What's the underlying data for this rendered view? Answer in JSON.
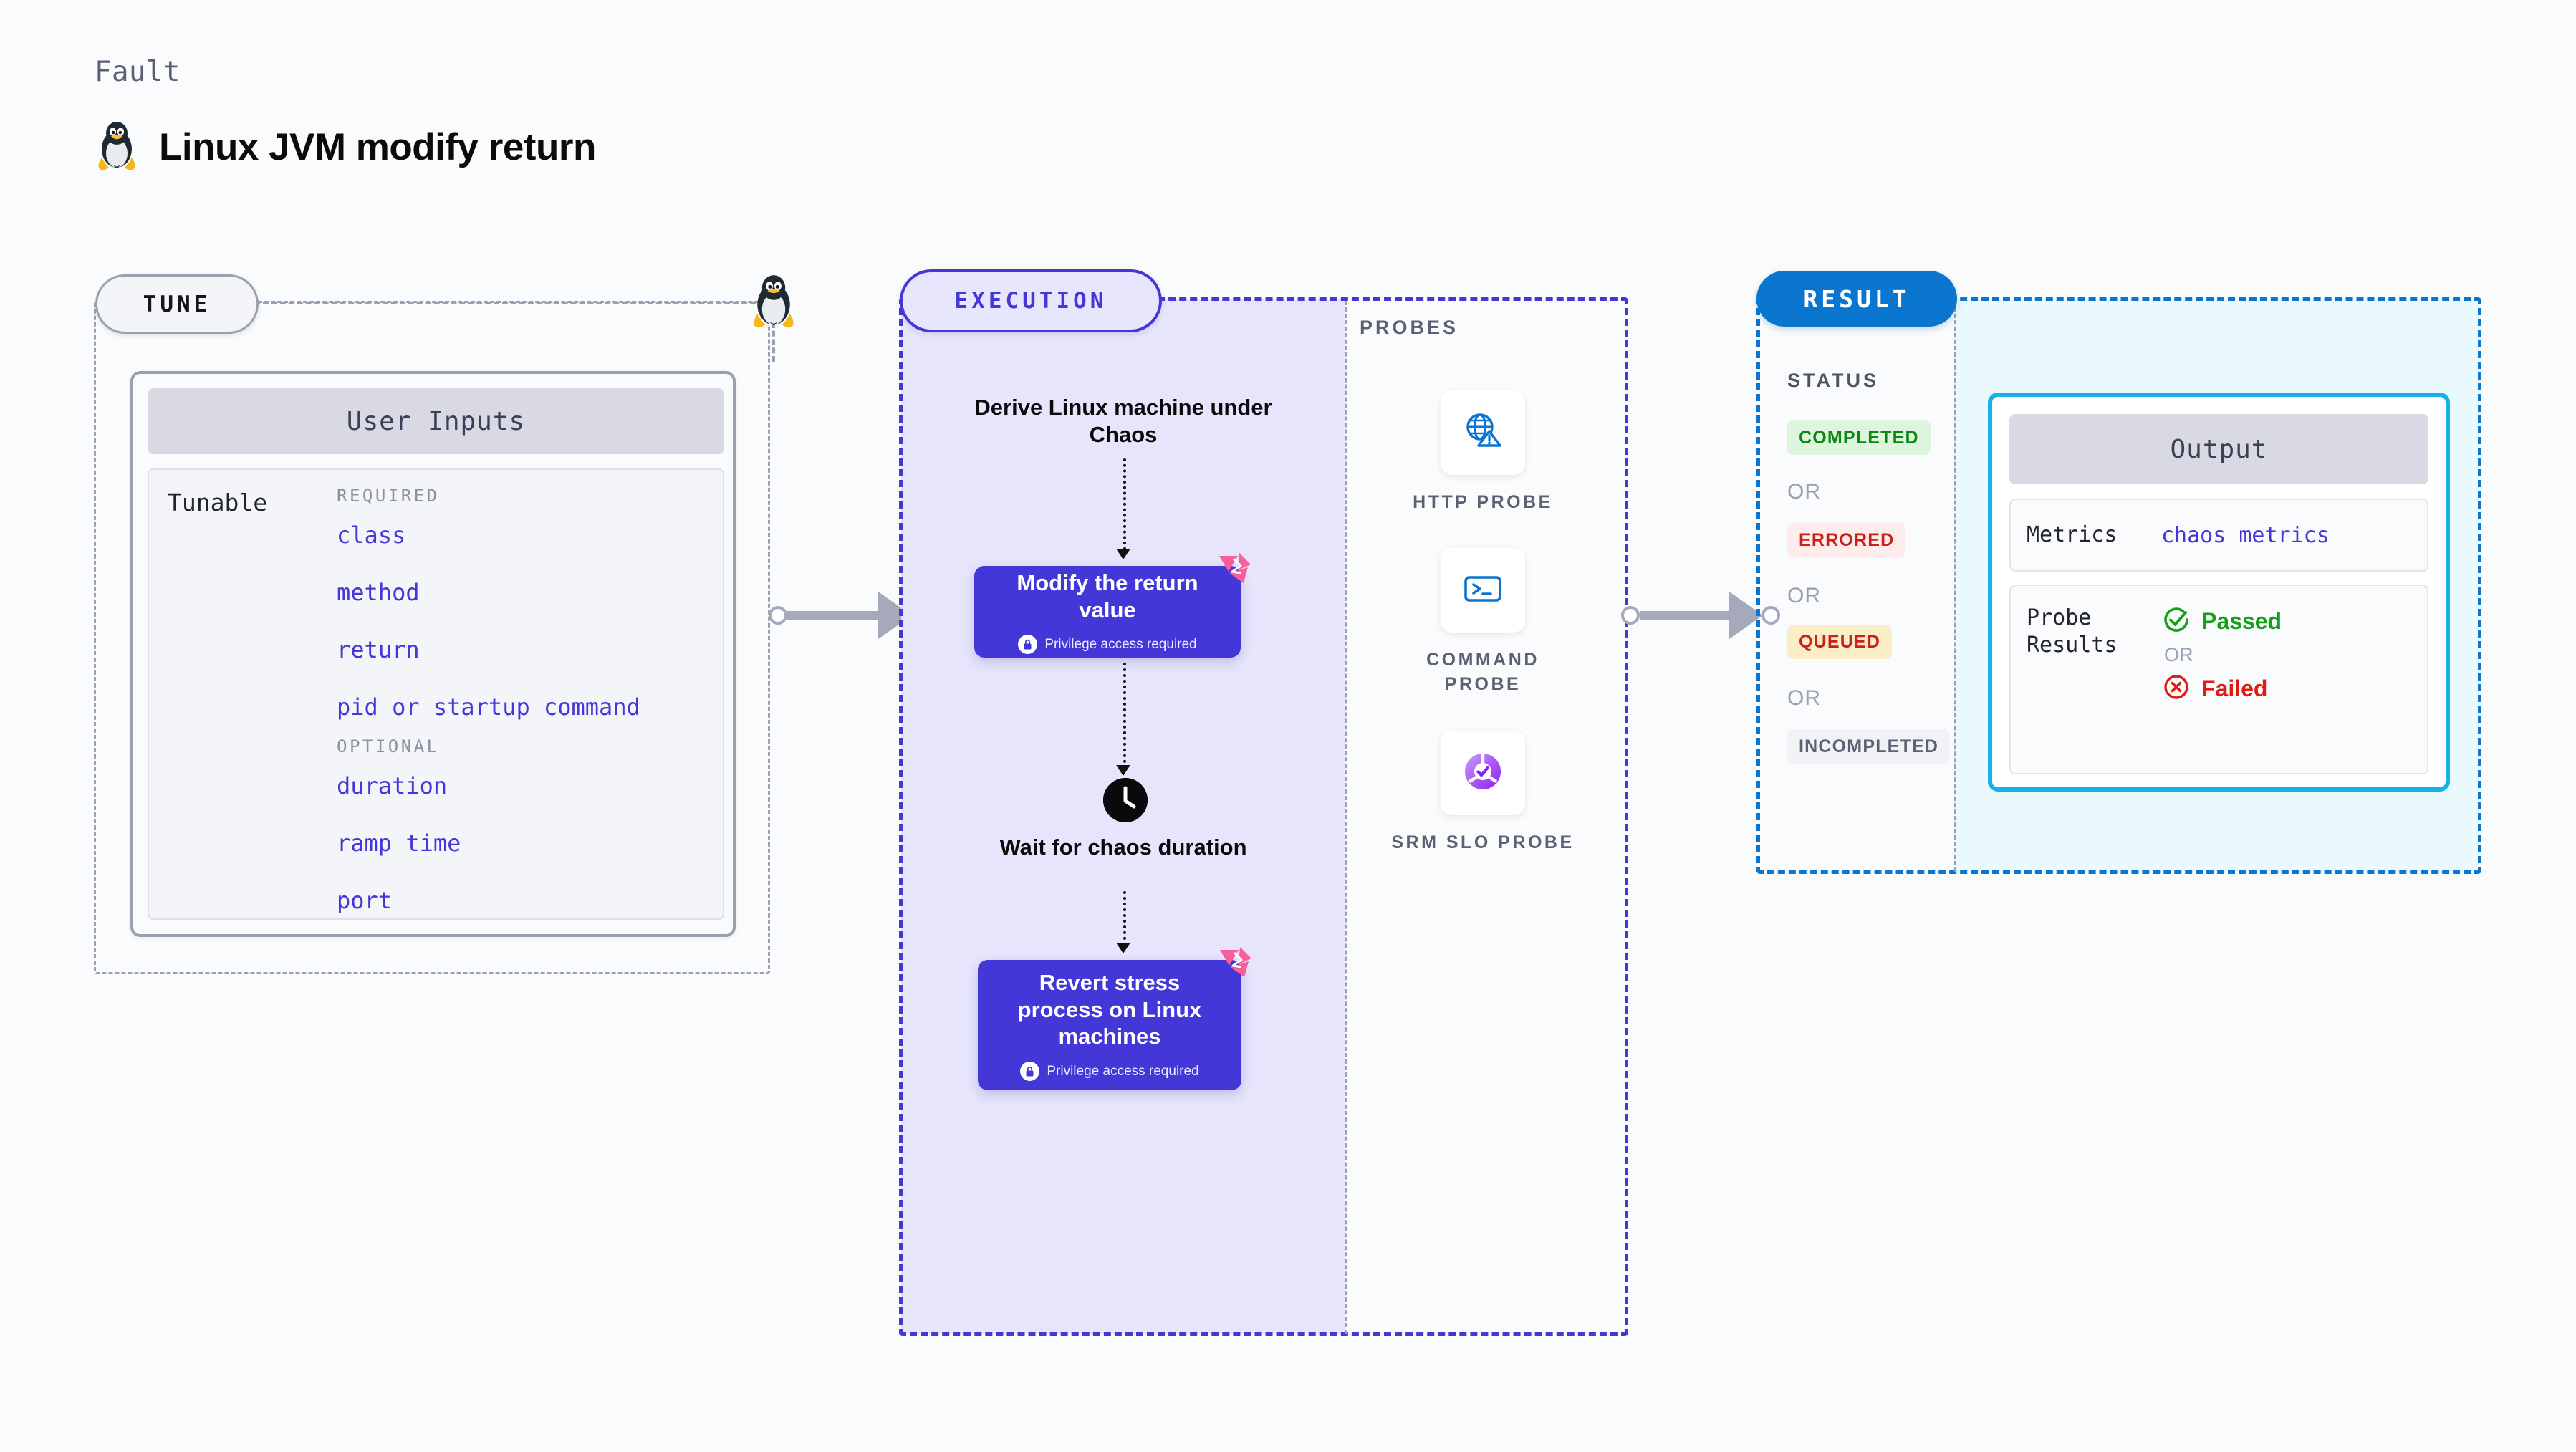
{
  "header": {
    "kicker": "Fault",
    "title": "Linux JVM modify return",
    "icon": "linux-tux-icon"
  },
  "tune": {
    "pill_label": "TUNE",
    "card_title": "User Inputs",
    "tunable_label": "Tunable",
    "required_label": "REQUIRED",
    "optional_label": "OPTIONAL",
    "required_items": [
      "class",
      "method",
      "return",
      "pid or startup command"
    ],
    "optional_items": [
      "duration",
      "ramp time",
      "port"
    ]
  },
  "execution": {
    "pill_label": "EXECUTION",
    "derive_text": "Derive Linux machine under Chaos",
    "modify_box": {
      "title": "Modify the return value",
      "sub": "Privilege access required",
      "badge_icon": "harness-chaos-icon",
      "lock_icon": "lock-icon"
    },
    "wait_text": "Wait for chaos duration",
    "clock_icon": "clock-icon",
    "revert_box": {
      "title": "Revert stress process on Linux machines",
      "sub": "Privilege access required",
      "badge_icon": "harness-chaos-icon",
      "lock_icon": "lock-icon"
    }
  },
  "probes": {
    "label": "PROBES",
    "items": [
      {
        "caption": "HTTP PROBE",
        "icon": "globe-warning-icon"
      },
      {
        "caption": "COMMAND PROBE",
        "icon": "terminal-icon"
      },
      {
        "caption": "SRM SLO PROBE",
        "icon": "srm-slo-icon"
      }
    ]
  },
  "result": {
    "pill_label": "RESULT",
    "status_label": "STATUS",
    "or_label": "OR",
    "statuses": [
      {
        "label": "COMPLETED",
        "bg": "#ddf5dc",
        "fg": "#0e8712"
      },
      {
        "label": "ERRORED",
        "bg": "#fdeceb",
        "fg": "#c9201a"
      },
      {
        "label": "QUEUED",
        "bg": "#fbeec6",
        "fg": "#c9201a"
      },
      {
        "label": "INCOMPLETED",
        "bg": "#f1f2f6",
        "fg": "#5b6072"
      }
    ],
    "output": {
      "title": "Output",
      "metrics_key": "Metrics",
      "metrics_value": "chaos metrics",
      "probe_results_key": "Probe Results",
      "passed_label": "Passed",
      "failed_label": "Failed",
      "or_label": "OR",
      "passed_icon": "check-circle-icon",
      "failed_icon": "x-circle-icon"
    }
  },
  "colors": {
    "accent_purple": "#4337d8",
    "accent_blue": "#0b76d0",
    "output_border": "#19b0e8",
    "gray_dash": "#9aa0b0",
    "pink_badge": "#fb5c9a"
  }
}
